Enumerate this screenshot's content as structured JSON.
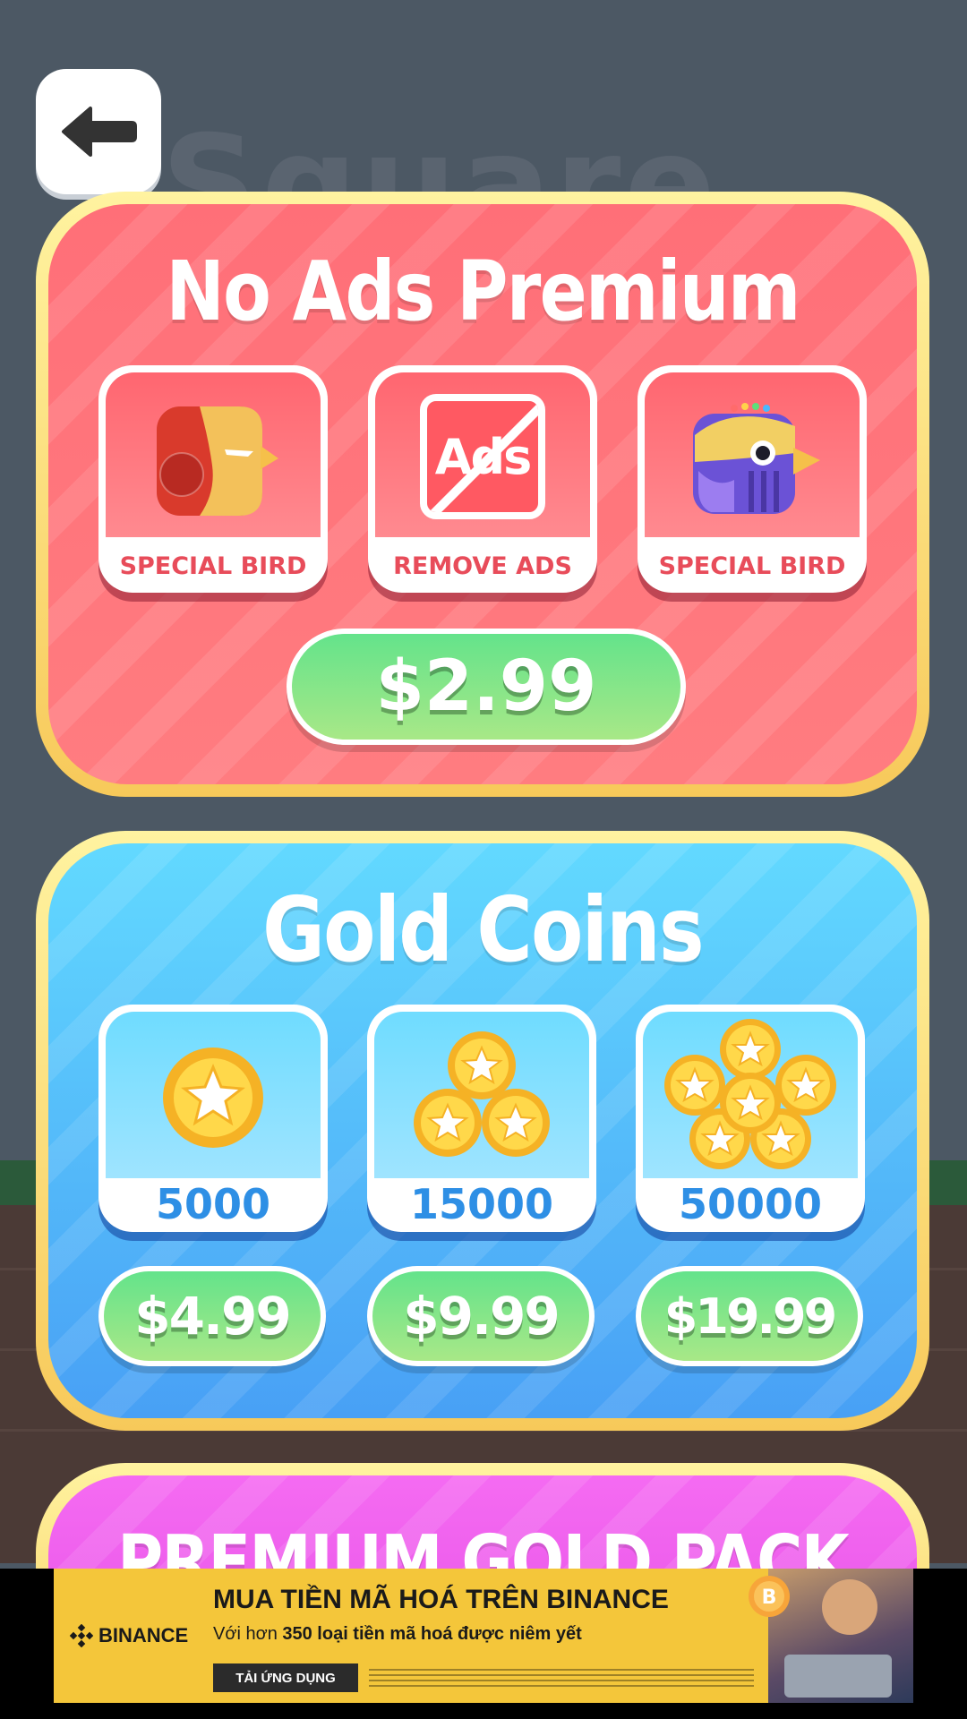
{
  "background": {
    "title": "Square"
  },
  "back_button": {
    "icon": "arrow-left-icon"
  },
  "no_ads_panel": {
    "title": "No Ads Premium",
    "items": [
      {
        "label": "SPECIAL BIRD",
        "icon": "armored-bird-icon"
      },
      {
        "label": "REMOVE ADS",
        "icon": "no-ads-icon",
        "icon_text": "Ads"
      },
      {
        "label": "SPECIAL BIRD",
        "icon": "purple-bird-icon"
      }
    ],
    "price": "$2.99"
  },
  "gold_coins_panel": {
    "title": "Gold Coins",
    "packs": [
      {
        "amount": "5000",
        "price": "$4.99",
        "icon": "single-coin-icon"
      },
      {
        "amount": "15000",
        "price": "$9.99",
        "icon": "three-coins-icon"
      },
      {
        "amount": "50000",
        "price": "$19.99",
        "icon": "coin-pile-icon"
      }
    ]
  },
  "premium_gold_panel": {
    "title": "PREMIUM GOLD PACK"
  },
  "ad_banner": {
    "brand": "BINANCE",
    "headline": "MUA TIỀN MÃ HOÁ TRÊN BINANCE",
    "sub_prefix": "Với hơn ",
    "sub_bold": "350 loại tiền mã hoá được niêm yết",
    "cta": "TẢI ỨNG DỤNG"
  },
  "colors": {
    "red_panel": "#ff7078",
    "blue_panel": "#4fb4f8",
    "pink_panel": "#e85ae8",
    "gold_border": "#fbe07a",
    "price_green": "#7ae38a"
  }
}
